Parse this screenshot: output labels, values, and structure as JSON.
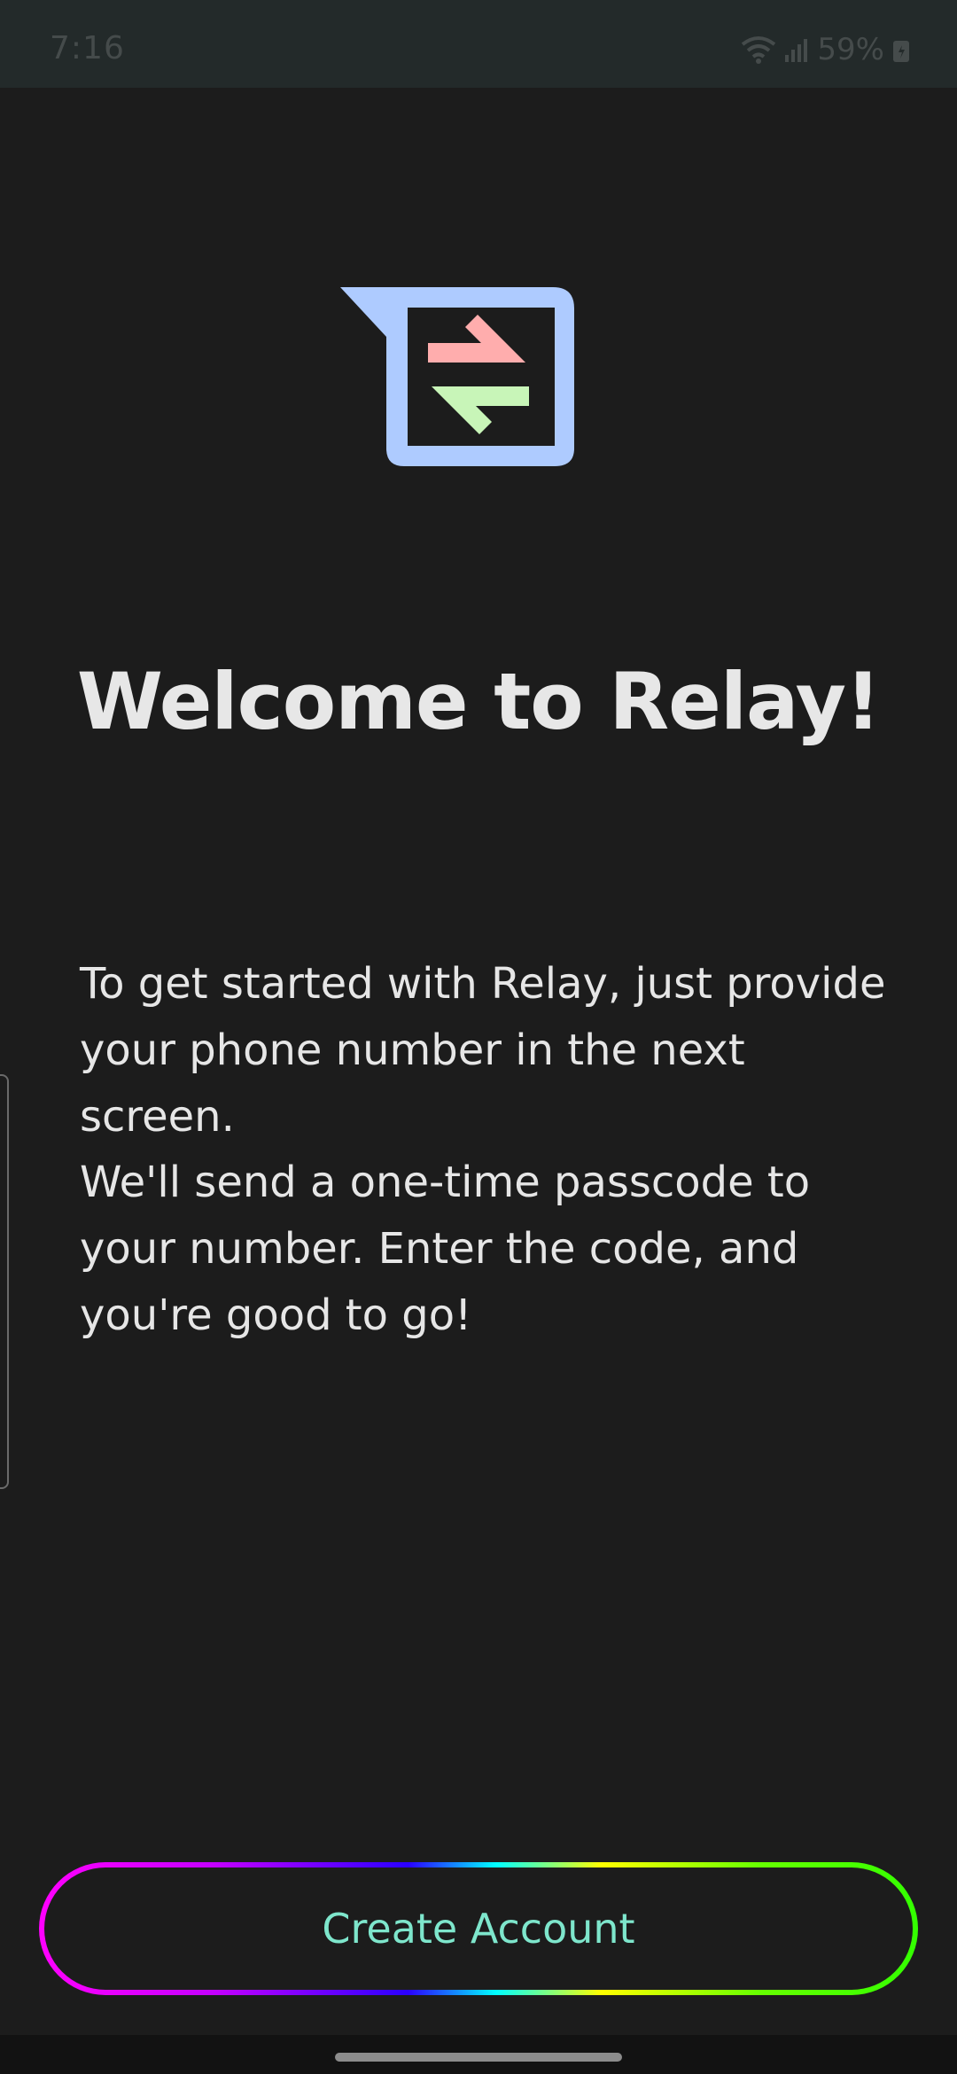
{
  "status_bar": {
    "time": "7:16",
    "battery": "59%",
    "icons": [
      "wifi-icon",
      "signal-icon",
      "battery-icon"
    ]
  },
  "logo": {
    "icon": "relay-logo-icon",
    "colors": {
      "frame": "#aecbff",
      "arrow_right": "#ffadad",
      "arrow_left": "#c8f5b8",
      "inner": "#1c1c1c"
    }
  },
  "welcome": {
    "title": "Welcome to Relay!",
    "paragraph_1": "To get started with Relay, just provide your phone number in the next screen.",
    "paragraph_2": "We'll send a one-time passcode to your number. Enter the code, and you're good to go!"
  },
  "actions": {
    "create_account_label": "Create Account"
  },
  "theme": {
    "background": "#1c1c1c",
    "text": "#e6e6e6",
    "button_text": "#7ee6cc"
  }
}
